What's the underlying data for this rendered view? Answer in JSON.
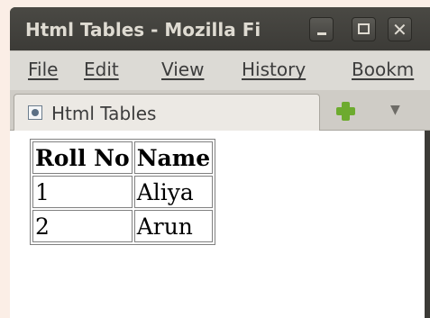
{
  "window": {
    "title": "Html Tables - Mozilla Fi",
    "controls": {
      "minimize": "minimize-icon",
      "maximize": "maximize-icon",
      "close": "close-icon"
    }
  },
  "menubar": {
    "items": [
      {
        "label": "File"
      },
      {
        "label": "Edit"
      },
      {
        "label": "View"
      },
      {
        "label": "History"
      },
      {
        "label": "Bookm"
      }
    ]
  },
  "tabs": {
    "items": [
      {
        "label": "Html Tables",
        "icon": "page-icon"
      }
    ],
    "new_tab_icon": "plus-icon",
    "list_icon": "chevron-down-icon"
  },
  "table": {
    "headers": [
      "Roll No",
      "Name"
    ],
    "rows": [
      [
        "1",
        "Aliya"
      ],
      [
        "2",
        "Arun"
      ]
    ]
  },
  "colors": {
    "titlebar": "#3c3b37",
    "menubar": "#dcdad5",
    "plus": "#6dab2f"
  }
}
